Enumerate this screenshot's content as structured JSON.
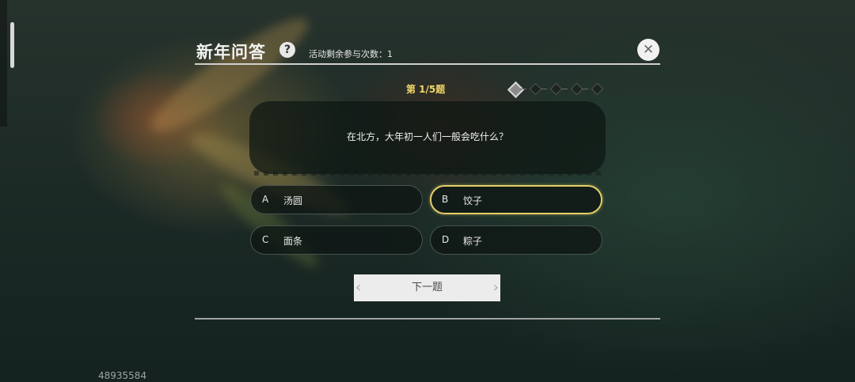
{
  "header": {
    "title": "新年问答",
    "help_icon": "?",
    "remaining_text": "活动剩余参与次数：1",
    "close_icon": "✕"
  },
  "progress": {
    "question_number_text": "第 1/5题",
    "current": 1,
    "total": 5
  },
  "question": {
    "text": "在北方，大年初一人们一般会吃什么？"
  },
  "options": [
    {
      "letter": "A",
      "text": "汤圆",
      "selected": false
    },
    {
      "letter": "B",
      "text": "饺子",
      "selected": true
    },
    {
      "letter": "C",
      "text": "面条",
      "selected": false
    },
    {
      "letter": "D",
      "text": "粽子",
      "selected": false
    }
  ],
  "next_button": {
    "label": "下一题"
  },
  "uid": "48935584",
  "colors": {
    "accent": "#e3cf67",
    "question_number": "#f0d76a"
  }
}
